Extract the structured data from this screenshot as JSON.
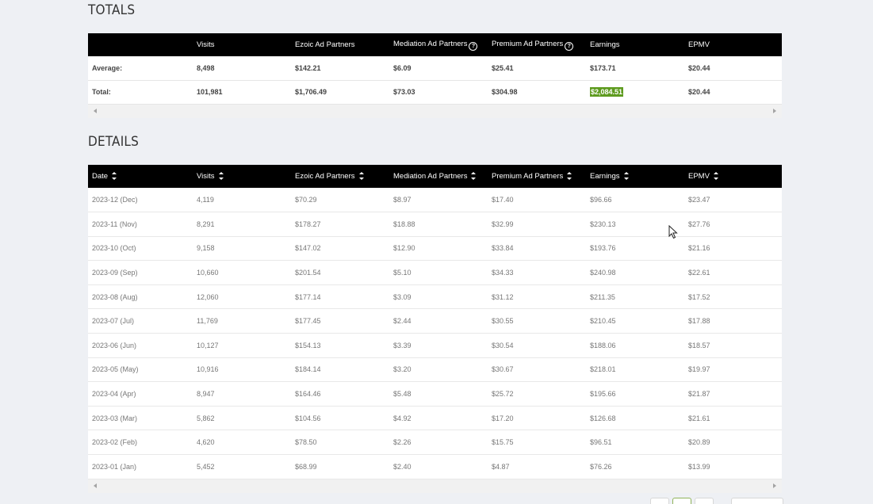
{
  "totals": {
    "title": "TOTALS",
    "headers": [
      "",
      "Visits",
      "Ezoic Ad Partners",
      "Mediation Ad Partners",
      "Premium Ad Partners",
      "Earnings",
      "EPMV"
    ],
    "rows": [
      [
        "Average:",
        "8,498",
        "$142.21",
        "$6.09",
        "$25.41",
        "$173.71",
        "$20.44"
      ],
      [
        "Total:",
        "101,981",
        "$1,706.49",
        "$73.03",
        "$304.98",
        "$2,084.51",
        "$20.44"
      ]
    ]
  },
  "details": {
    "title": "DETAILS",
    "headers": [
      "Date",
      "Visits",
      "Ezoic Ad Partners",
      "Mediation Ad Partners",
      "Premium Ad Partners",
      "Earnings",
      "EPMV"
    ],
    "rows": [
      [
        "2023-12 (Dec)",
        "4,119",
        "$70.29",
        "$8.97",
        "$17.40",
        "$96.66",
        "$23.47"
      ],
      [
        "2023-11 (Nov)",
        "8,291",
        "$178.27",
        "$18.88",
        "$32.99",
        "$230.13",
        "$27.76"
      ],
      [
        "2023-10 (Oct)",
        "9,158",
        "$147.02",
        "$12.90",
        "$33.84",
        "$193.76",
        "$21.16"
      ],
      [
        "2023-09 (Sep)",
        "10,660",
        "$201.54",
        "$5.10",
        "$34.33",
        "$240.98",
        "$22.61"
      ],
      [
        "2023-08 (Aug)",
        "12,060",
        "$177.14",
        "$3.09",
        "$31.12",
        "$211.35",
        "$17.52"
      ],
      [
        "2023-07 (Jul)",
        "11,769",
        "$177.45",
        "$2.44",
        "$30.55",
        "$210.45",
        "$17.88"
      ],
      [
        "2023-06 (Jun)",
        "10,127",
        "$154.13",
        "$3.39",
        "$30.54",
        "$188.06",
        "$18.57"
      ],
      [
        "2023-05 (May)",
        "10,916",
        "$184.14",
        "$3.20",
        "$30.67",
        "$218.01",
        "$19.97"
      ],
      [
        "2023-04 (Apr)",
        "8,947",
        "$164.46",
        "$5.48",
        "$25.72",
        "$195.66",
        "$21.87"
      ],
      [
        "2023-03 (Mar)",
        "5,862",
        "$104.56",
        "$4.92",
        "$17.20",
        "$126.68",
        "$21.61"
      ],
      [
        "2023-02 (Feb)",
        "4,620",
        "$78.50",
        "$2.26",
        "$15.75",
        "$96.51",
        "$20.89"
      ],
      [
        "2023-01 (Jan)",
        "5,452",
        "$68.99",
        "$2.40",
        "$4.87",
        "$76.26",
        "$13.99"
      ]
    ]
  },
  "colors": {
    "header_bg": "#000000",
    "highlight": "#5e9b1f",
    "page_bg": "#eef0f4"
  }
}
